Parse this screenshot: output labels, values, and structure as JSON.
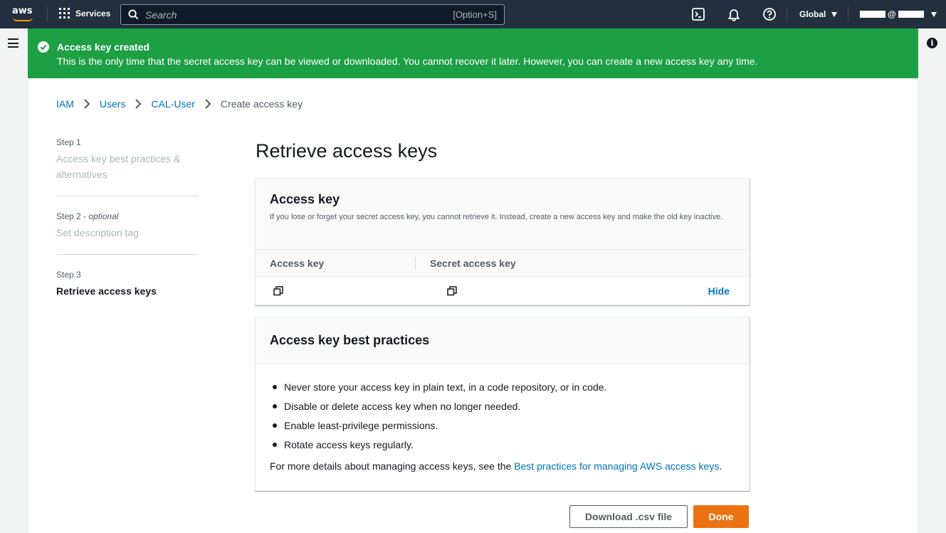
{
  "topnav": {
    "logo_text": "aws",
    "services_label": "Services",
    "search_placeholder": "Search",
    "search_shortcut": "[Option+S]",
    "region_label": "Global",
    "account_at": "@"
  },
  "flash": {
    "title": "Access key created",
    "message": "This is the only time that the secret access key can be viewed or downloaded. You cannot recover it later. However, you can create a new access key any time.",
    "color": "#1d9f43"
  },
  "breadcrumb": {
    "items": [
      "IAM",
      "Users",
      "CAL-User"
    ],
    "current": "Create access key"
  },
  "steps": [
    {
      "num": "Step 1",
      "optional": "",
      "title": "Access key best practices & alternatives"
    },
    {
      "num": "Step 2 -",
      "optional": "optional",
      "title": "Set description tag"
    },
    {
      "num": "Step 3",
      "optional": "",
      "title": "Retrieve access keys"
    }
  ],
  "page_title": "Retrieve access keys",
  "access_key_card": {
    "title": "Access key",
    "description": "If you lose or forget your secret access key, you cannot retrieve it. Instead, create a new access key and make the old key inactive.",
    "col_access_key": "Access key",
    "col_secret_key": "Secret access key",
    "hide_label": "Hide"
  },
  "best_practices_card": {
    "title": "Access key best practices",
    "items": [
      "Never store your access key in plain text, in a code repository, or in code.",
      "Disable or delete access key when no longer needed.",
      "Enable least-privilege permissions.",
      "Rotate access keys regularly."
    ],
    "more_prefix": "For more details about managing access keys, see the ",
    "more_link": "Best practices for managing AWS access keys",
    "more_suffix": "."
  },
  "buttons": {
    "download": "Download .csv file",
    "done": "Done"
  },
  "colors": {
    "nav_bg": "#232f3e",
    "link": "#0073bb",
    "primary": "#ec7211"
  }
}
